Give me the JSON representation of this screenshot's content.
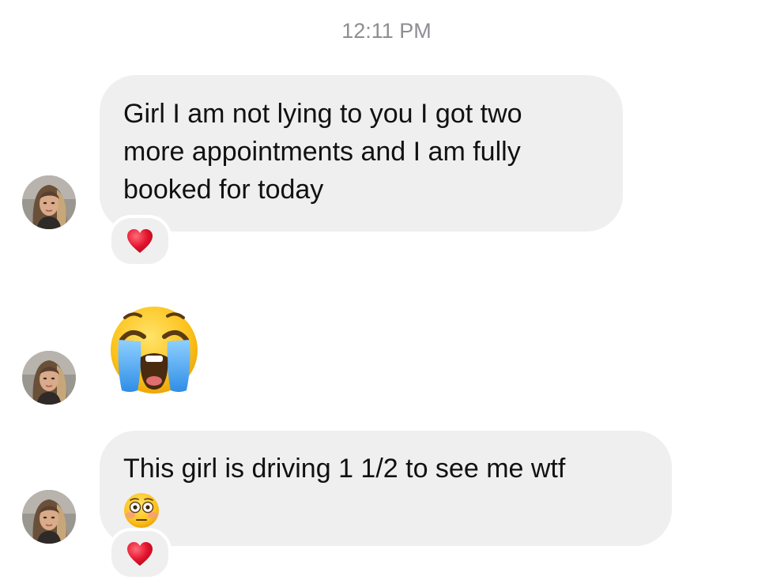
{
  "header": {
    "timestamp": "12:11 PM"
  },
  "messages": [
    {
      "text": "Girl I am not lying to you I got two\nmore appointments and I am fully\nbooked for today",
      "reaction": "red-heart",
      "avatar": "contact-avatar"
    },
    {
      "emoji": "loudly-crying-face",
      "avatar": "contact-avatar"
    },
    {
      "text": "This girl is driving 1 1/2 to see me wtf",
      "trailing_emoji": "flushed-face",
      "reaction": "red-heart",
      "avatar": "contact-avatar"
    }
  ],
  "colors": {
    "bubble": "#efefef",
    "timestamp": "#8e8e93",
    "heart": "#e3132d",
    "emoji_yellow": "#fcc21b",
    "tears": "#3ea5ee"
  }
}
